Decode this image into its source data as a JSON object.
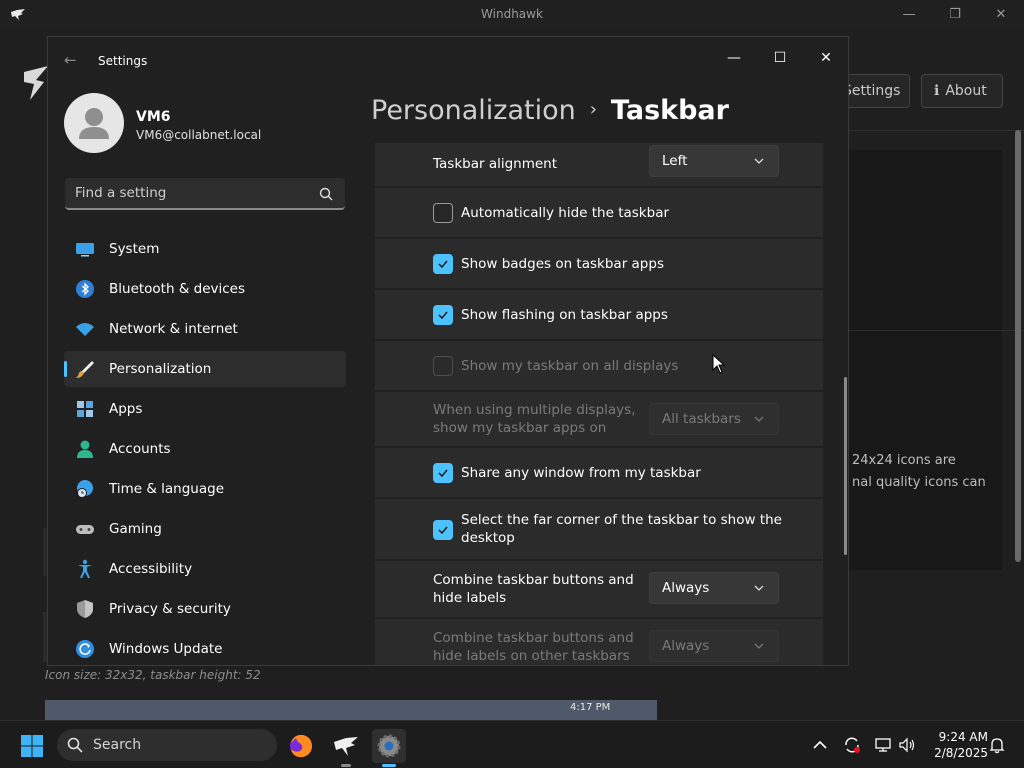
{
  "background_app": {
    "title": "Windhawk",
    "buttons": {
      "settings": "Settings",
      "about": "About"
    },
    "description_lines": [
      "24x24 icons are",
      "nal quality icons can"
    ],
    "icon_size_note": "Icon size: 32x32, taskbar height: 52",
    "preview_time": "4:17 PM"
  },
  "settings_window": {
    "title": "Settings",
    "profile": {
      "name": "VM6",
      "email": "VM6@collabnet.local"
    },
    "search": {
      "placeholder": "Find a setting"
    },
    "nav": [
      {
        "label": "System",
        "icon": "monitor-icon"
      },
      {
        "label": "Bluetooth & devices",
        "icon": "bluetooth-icon"
      },
      {
        "label": "Network & internet",
        "icon": "wifi-icon"
      },
      {
        "label": "Personalization",
        "icon": "brush-icon",
        "selected": true
      },
      {
        "label": "Apps",
        "icon": "apps-grid-icon"
      },
      {
        "label": "Accounts",
        "icon": "person-icon"
      },
      {
        "label": "Time & language",
        "icon": "globe-clock-icon"
      },
      {
        "label": "Gaming",
        "icon": "gamepad-icon"
      },
      {
        "label": "Accessibility",
        "icon": "accessibility-icon"
      },
      {
        "label": "Privacy & security",
        "icon": "shield-icon"
      },
      {
        "label": "Windows Update",
        "icon": "update-icon"
      }
    ],
    "breadcrumb": {
      "parent": "Personalization",
      "separator": "›",
      "current": "Taskbar"
    },
    "settings": {
      "alignment": {
        "label": "Taskbar alignment",
        "value": "Left"
      },
      "auto_hide": {
        "label": "Automatically hide the taskbar",
        "checked": false
      },
      "badges": {
        "label": "Show badges on taskbar apps",
        "checked": true
      },
      "flashing": {
        "label": "Show flashing on taskbar apps",
        "checked": true
      },
      "all_displays": {
        "label": "Show my taskbar on all displays",
        "checked": false,
        "disabled": true
      },
      "multi_display": {
        "line1": "When using multiple displays,",
        "line2": "show my taskbar apps on",
        "value": "All taskbars",
        "disabled": true
      },
      "share_window": {
        "label": "Share any window from my taskbar",
        "checked": true
      },
      "far_corner": {
        "line1": "Select the far corner of the taskbar to show the",
        "line2": "desktop",
        "checked": true
      },
      "combine": {
        "line1": "Combine taskbar buttons and",
        "line2": "hide labels",
        "value": "Always"
      },
      "combine_other": {
        "line1": "Combine taskbar buttons and",
        "line2": "hide labels on other taskbars",
        "value": "Always",
        "disabled": true
      }
    }
  },
  "taskbar": {
    "search_label": "Search",
    "time": "9:24 AM",
    "date": "2/8/2025"
  },
  "colors": {
    "accent": "#4cc2ff",
    "background": "#202020",
    "card": "#2b2b2b"
  }
}
